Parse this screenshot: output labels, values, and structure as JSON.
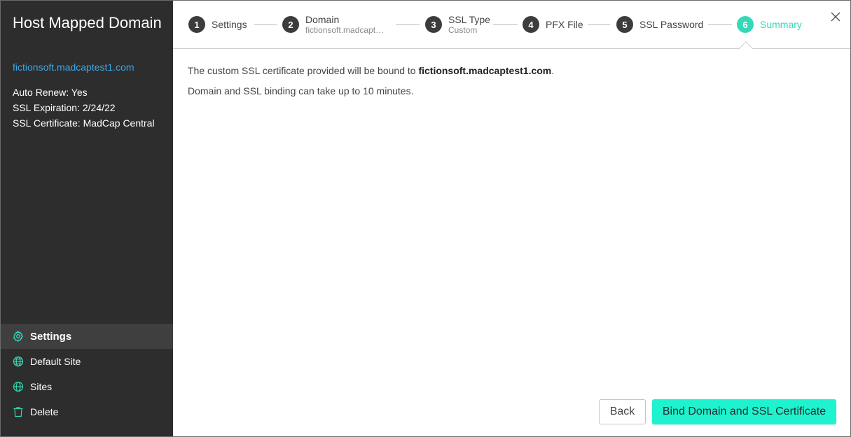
{
  "sidebar": {
    "title": "Host Mapped Domain",
    "domain_link": "fictionsoft.madcaptest1.com",
    "auto_renew": "Auto Renew: Yes",
    "ssl_expiration": "SSL Expiration: 2/24/22",
    "ssl_certificate": "SSL Certificate: MadCap Central",
    "nav": [
      {
        "label": "Settings",
        "icon": "gear-icon"
      },
      {
        "label": "Default Site",
        "icon": "globe-home-icon"
      },
      {
        "label": "Sites",
        "icon": "globe-icon"
      },
      {
        "label": "Delete",
        "icon": "trash-icon"
      }
    ]
  },
  "stepper": {
    "steps": [
      {
        "num": "1",
        "label": "Settings",
        "sub": ""
      },
      {
        "num": "2",
        "label": "Domain",
        "sub": "fictionsoft.madcapte..."
      },
      {
        "num": "3",
        "label": "SSL Type",
        "sub": "Custom"
      },
      {
        "num": "4",
        "label": "PFX File",
        "sub": ""
      },
      {
        "num": "5",
        "label": "SSL Password",
        "sub": ""
      },
      {
        "num": "6",
        "label": "Summary",
        "sub": ""
      }
    ],
    "active_step": 6
  },
  "content": {
    "line1_prefix": "The custom SSL certificate provided will be bound to ",
    "line1_domain": "fictionsoft.madcaptest1.com",
    "line1_suffix": ".",
    "line2": "Domain and SSL binding can take up to 10 minutes."
  },
  "buttons": {
    "back": "Back",
    "bind": "Bind Domain and SSL Certificate"
  },
  "colors": {
    "accent": "#33d9b8",
    "primary_button": "#1ef2cf",
    "sidebar_bg": "#2d2d2d",
    "link": "#3ea7e6"
  }
}
